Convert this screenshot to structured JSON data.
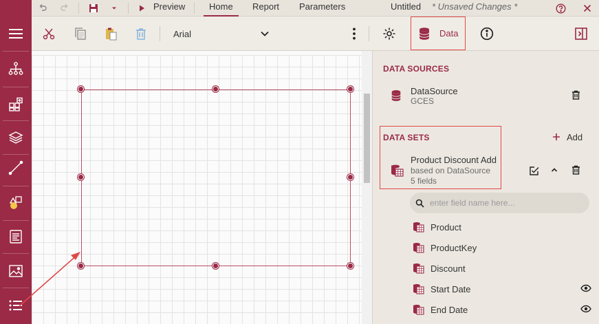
{
  "menubar": {
    "preview_label": "Preview",
    "tabs": [
      "Home",
      "Report",
      "Parameters"
    ],
    "doc_title": "Untitled",
    "unsaved": "* Unsaved Changes *"
  },
  "toolbar": {
    "font_name": "Arial",
    "data_label": "Data"
  },
  "data_sources": {
    "title": "DATA SOURCES",
    "items": [
      {
        "name": "DataSource",
        "subtitle": "GCES"
      }
    ]
  },
  "data_sets": {
    "title": "DATA SETS",
    "add_label": "Add",
    "items": [
      {
        "name": "Product Discount Add",
        "based_on": "based on DataSource",
        "fields_count": "5 fields"
      }
    ],
    "search_placeholder": "enter field name here...",
    "fields": [
      "Product",
      "ProductKey",
      "Discount",
      "Start Date",
      "End Date"
    ]
  },
  "colors": {
    "brand": "#9a2a45",
    "highlight": "#e04848"
  }
}
